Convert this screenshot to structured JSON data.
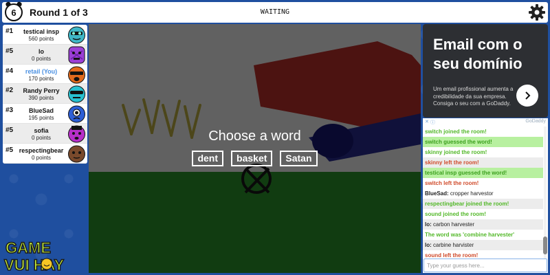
{
  "topbar": {
    "timer": "6",
    "round_label": "Round 1 of 3",
    "status": "WAITING"
  },
  "players": [
    {
      "rank": "#1",
      "name": "testical insp",
      "points": "560 points",
      "you": false,
      "color": "#3fb7c7"
    },
    {
      "rank": "#5",
      "name": "lo",
      "points": "0 points",
      "you": false,
      "color": "#9b3fd6"
    },
    {
      "rank": "#4",
      "name": "retail (You)",
      "points": "170 points",
      "you": true,
      "color": "#e26a1c"
    },
    {
      "rank": "#2",
      "name": "Randy Perry",
      "points": "390 points",
      "you": false,
      "color": "#27c0d0"
    },
    {
      "rank": "#3",
      "name": "BlueSad",
      "points": "195 points",
      "you": false,
      "color": "#2e5fd6"
    },
    {
      "rank": "#5",
      "name": "sofia",
      "points": "0 points",
      "you": false,
      "color": "#b72fc9"
    },
    {
      "rank": "#5",
      "name": "respectingbear",
      "points": "0 points",
      "you": false,
      "color": "#7a4a2c"
    }
  ],
  "logo": {
    "line1": "GAME",
    "line2": "VUI HAY"
  },
  "canvas": {
    "prompt": "Choose a word",
    "choices": [
      "dent",
      "basket",
      "Satan"
    ]
  },
  "ad": {
    "headline": "Email com o seu domínio",
    "body": "Um email profissional aumenta a credibilidade da sua empresa. Consiga o seu com a GoDaddy.",
    "brand": "GoDaddy",
    "close_glyph": "✕",
    "info_glyph": "ⓘ",
    "accent": "#2d2f33"
  },
  "chat": {
    "messages": [
      {
        "type": "green",
        "name": "",
        "text": "switch joined the room!"
      },
      {
        "type": "guess",
        "name": "",
        "text": "switch guessed the word!"
      },
      {
        "type": "green",
        "name": "",
        "text": "skinny joined the room!"
      },
      {
        "type": "red",
        "name": "",
        "text": "skinny left the room!"
      },
      {
        "type": "guess",
        "name": "",
        "text": "testical insp guessed the word!"
      },
      {
        "type": "red",
        "name": "",
        "text": "switch left the room!"
      },
      {
        "type": "normal",
        "name": "BlueSad:",
        "text": " cropper harvestor"
      },
      {
        "type": "green",
        "name": "",
        "text": "respectingbear joined the room!"
      },
      {
        "type": "green",
        "name": "",
        "text": "sound joined the room!"
      },
      {
        "type": "normal",
        "name": "lo:",
        "text": " carbon harvester"
      },
      {
        "type": "green",
        "name": "",
        "text": "The word was 'combine harvester'"
      },
      {
        "type": "normal",
        "name": "lo:",
        "text": " carbine harvister"
      },
      {
        "type": "red",
        "name": "",
        "text": "sound left the room!"
      }
    ],
    "input_placeholder": "Type your guess here..."
  }
}
